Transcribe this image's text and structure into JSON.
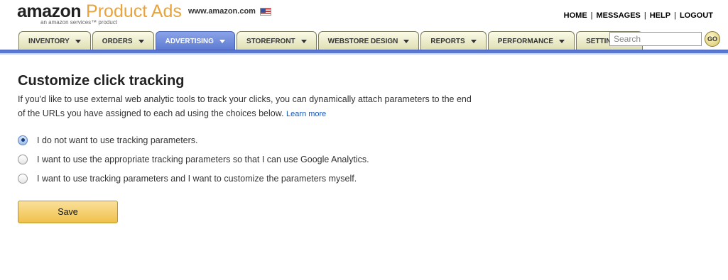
{
  "header": {
    "logo_brand": "amazon",
    "logo_product": "Product Ads",
    "logo_tagline": "an amazon services™ product",
    "site_url": "www.amazon.com",
    "flag_icon": "us-flag-icon",
    "top_links": [
      "HOME",
      "MESSAGES",
      "HELP",
      "LOGOUT"
    ],
    "top_link_separator": "|"
  },
  "nav": {
    "tabs": [
      {
        "label": "INVENTORY",
        "active": false
      },
      {
        "label": "ORDERS",
        "active": false
      },
      {
        "label": "ADVERTISING",
        "active": true
      },
      {
        "label": "STOREFRONT",
        "active": false
      },
      {
        "label": "WEBSTORE DESIGN",
        "active": false
      },
      {
        "label": "REPORTS",
        "active": false
      },
      {
        "label": "PERFORMANCE",
        "active": false
      },
      {
        "label": "SETTINGS",
        "active": false
      }
    ],
    "active_color": "#5a78d0"
  },
  "search": {
    "placeholder": "Search",
    "value": "",
    "go_label": "GO"
  },
  "main": {
    "title": "Customize click tracking",
    "description": "If you'd like to use external web analytic tools to track your clicks, you can dynamically attach parameters to the end of the URLs you have assigned to each ad using the choices below.",
    "learn_more": "Learn more",
    "options": [
      {
        "label": "I do not want to use tracking parameters.",
        "checked": true
      },
      {
        "label": "I want to use the appropriate tracking parameters so that I can use Google Analytics.",
        "checked": false
      },
      {
        "label": "I want to use tracking parameters and I want to customize the parameters myself.",
        "checked": false
      }
    ],
    "save_label": "Save",
    "save_color": "#f0c14b"
  }
}
